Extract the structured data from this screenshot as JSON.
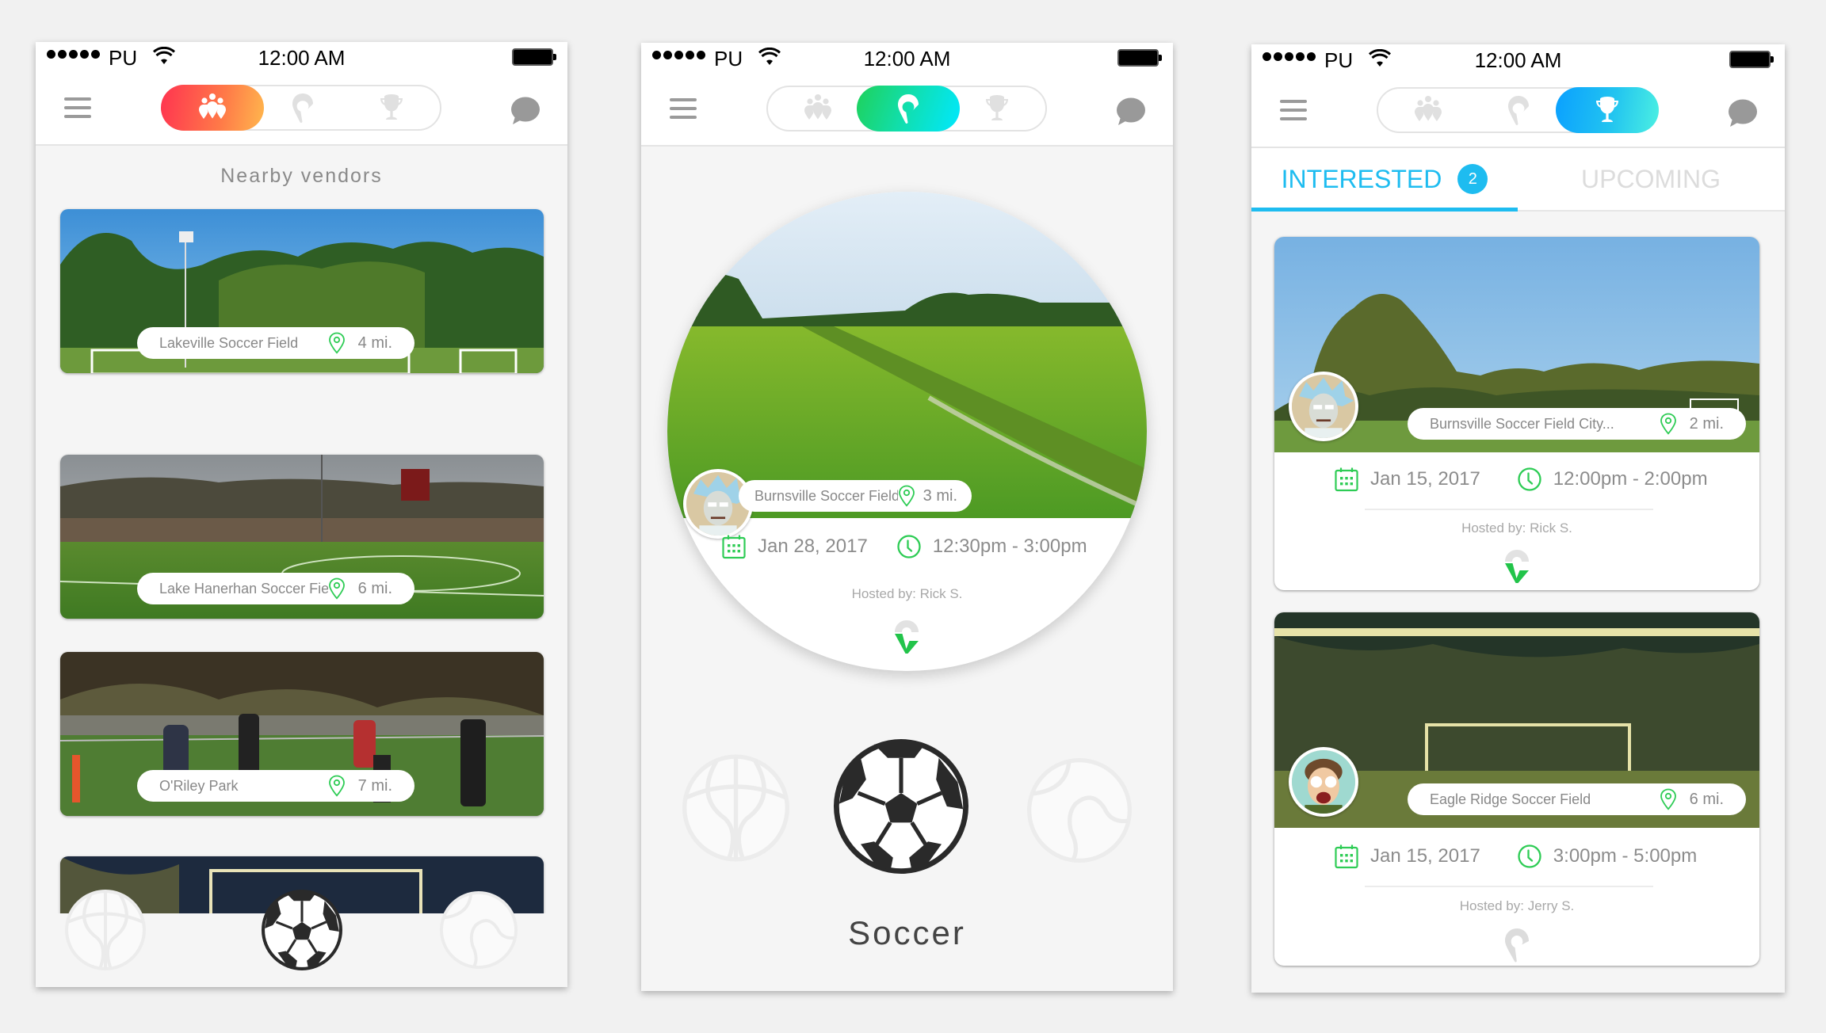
{
  "status_bar": {
    "signal_dots": 5,
    "carrier": "PU",
    "time": "12:00 AM",
    "icons": [
      "wifi-icon",
      "battery-icon"
    ]
  },
  "nav": {
    "menu_icon": "hamburger-menu-icon",
    "chat_icon": "chat-bubble-icon",
    "segments": [
      {
        "id": "vendors",
        "icon": "people-pins-icon"
      },
      {
        "id": "pickup",
        "icon": "location-pin-icon"
      },
      {
        "id": "events",
        "icon": "trophy-icon"
      }
    ]
  },
  "colors": {
    "vendors_gradient": [
      "#ff3350",
      "#ffb74d"
    ],
    "pickup_gradient": [
      "#1fd15a",
      "#00e8ff"
    ],
    "events_gradient": [
      "#0aa0ff",
      "#4cf0e2"
    ],
    "accent_green": "#2ecc55",
    "accent_blue": "#1ebcf0"
  },
  "screen1": {
    "active_segment": "vendors",
    "title": "Nearby vendors",
    "vendors": [
      {
        "name": "Lakeville Soccer Field",
        "distance": "4 mi."
      },
      {
        "name": "Lake Hanerhan Soccer Field",
        "distance": "6 mi."
      },
      {
        "name": "O'Riley Park",
        "distance": "7 mi."
      },
      {
        "name": "",
        "distance": ""
      }
    ],
    "sports": [
      {
        "name": "basketball",
        "icon": "basketball-icon",
        "selected": false
      },
      {
        "name": "soccer",
        "icon": "soccer-ball-icon",
        "selected": true
      },
      {
        "name": "tennis",
        "icon": "tennis-ball-icon",
        "selected": false
      }
    ]
  },
  "screen2": {
    "active_segment": "pickup",
    "game": {
      "location": "Burnsville Soccer Field City...",
      "distance": "3 mi.",
      "date": "Jan 28, 2017",
      "time": "12:30pm - 3:00pm",
      "hosted_by": "Hosted by: Rick S.",
      "host_avatar": "rick-avatar"
    },
    "selected_sport_label": "Soccer",
    "sports": [
      {
        "name": "basketball",
        "icon": "basketball-icon",
        "selected": false
      },
      {
        "name": "soccer",
        "icon": "soccer-ball-icon",
        "selected": true
      },
      {
        "name": "tennis",
        "icon": "tennis-ball-icon",
        "selected": false
      }
    ]
  },
  "screen3": {
    "active_segment": "events",
    "tabs": [
      {
        "label": "INTERESTED",
        "badge": "2",
        "active": true
      },
      {
        "label": "UPCOMING",
        "active": false
      }
    ],
    "events": [
      {
        "location": "Burnsville Soccer Field City...",
        "distance": "2 mi.",
        "date": "Jan 15, 2017",
        "time": "12:00pm - 2:00pm",
        "hosted_by": "Hosted by: Rick S.",
        "host_avatar": "rick-avatar",
        "joined": true
      },
      {
        "location": "Eagle Ridge Soccer Field",
        "distance": "6 mi.",
        "date": "Jan 15, 2017",
        "time": "3:00pm - 5:00pm",
        "hosted_by": "Hosted by: Jerry S.",
        "host_avatar": "jerry-avatar",
        "joined": false
      }
    ]
  }
}
